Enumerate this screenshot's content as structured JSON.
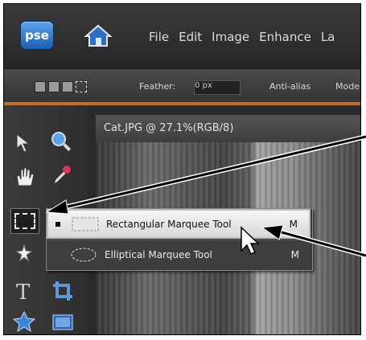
{
  "app": {
    "logo_text": "pse",
    "brand_color": "#2a74c9",
    "menu": [
      "File",
      "Edit",
      "Image",
      "Enhance",
      "La"
    ]
  },
  "options_bar": {
    "feather_label": "Feather:",
    "feather_value": "0 px",
    "antialias_label": "Anti-alias",
    "mode_label": "Mode"
  },
  "document": {
    "tab_title": "Cat.JPG @ 27.1%(RGB/8)"
  },
  "flyout": {
    "items": [
      {
        "label": "Rectangular Marquee Tool",
        "shortcut": "M",
        "selected": true,
        "icon": "rectangular-marquee-icon"
      },
      {
        "label": "Elliptical Marquee Tool",
        "shortcut": "M",
        "selected": false,
        "icon": "elliptical-marquee-icon"
      }
    ]
  },
  "tools": [
    "move-icon",
    "zoom-icon",
    "hand-icon",
    "eyedropper-icon",
    "rectangular-marquee-icon",
    "magic-wand-icon",
    "type-icon",
    "crop-icon",
    "shape-icon",
    "screen-icon"
  ],
  "colors": {
    "accent_rule": "#c86b23",
    "menu_text": "#dcdcdc"
  }
}
